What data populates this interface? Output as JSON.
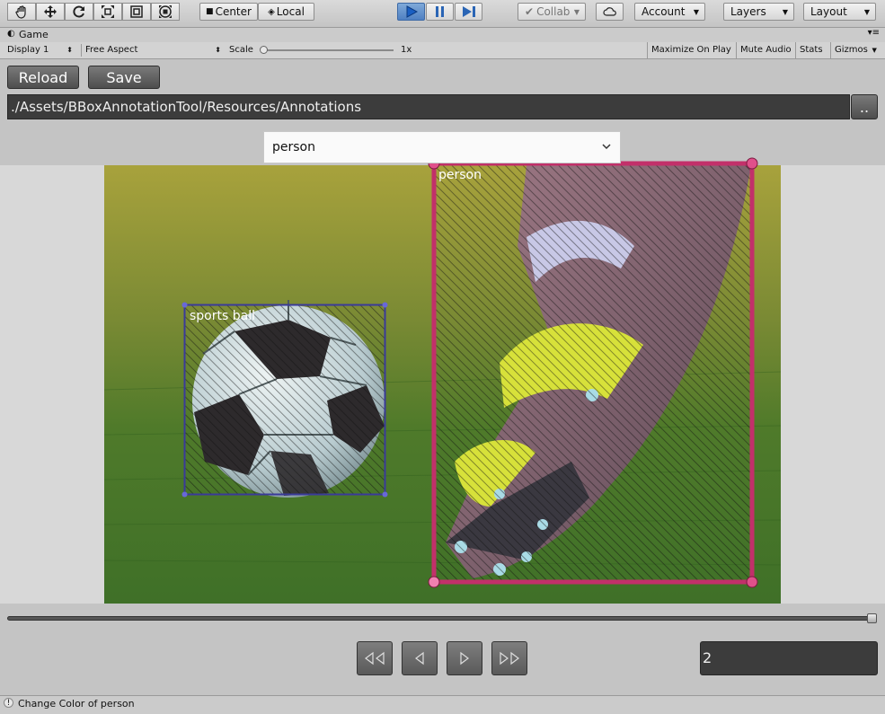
{
  "toolbar": {
    "tools": [
      "hand-tool-icon",
      "move-tool-icon",
      "rotate-tool-icon",
      "scale-tool-icon",
      "rect-tool-icon",
      "transform-tool-icon"
    ],
    "pivot_label": "Center",
    "space_label": "Local",
    "collab_label": "Collab",
    "account_label": "Account",
    "layers_label": "Layers",
    "layout_label": "Layout"
  },
  "game_tab": {
    "title": "Game"
  },
  "game_toolbar": {
    "display": "Display 1",
    "aspect": "Free Aspect",
    "scale_label": "Scale",
    "scale_value": "1x",
    "maximize": "Maximize On Play",
    "mute": "Mute Audio",
    "stats": "Stats",
    "gizmos": "Gizmos"
  },
  "annotation_tool": {
    "reload_label": "Reload",
    "save_label": "Save",
    "path": "./Assets/BBoxAnnotationTool/Resources/Annotations",
    "browse_label": "..",
    "class_select": "person",
    "boxes": [
      {
        "label": "sports ball",
        "color": "#3a3a9a"
      },
      {
        "label": "person",
        "color": "#c2306a"
      }
    ],
    "frame_slider": 1.0,
    "frame_number": "2"
  },
  "status": {
    "message": "Change Color of person"
  }
}
